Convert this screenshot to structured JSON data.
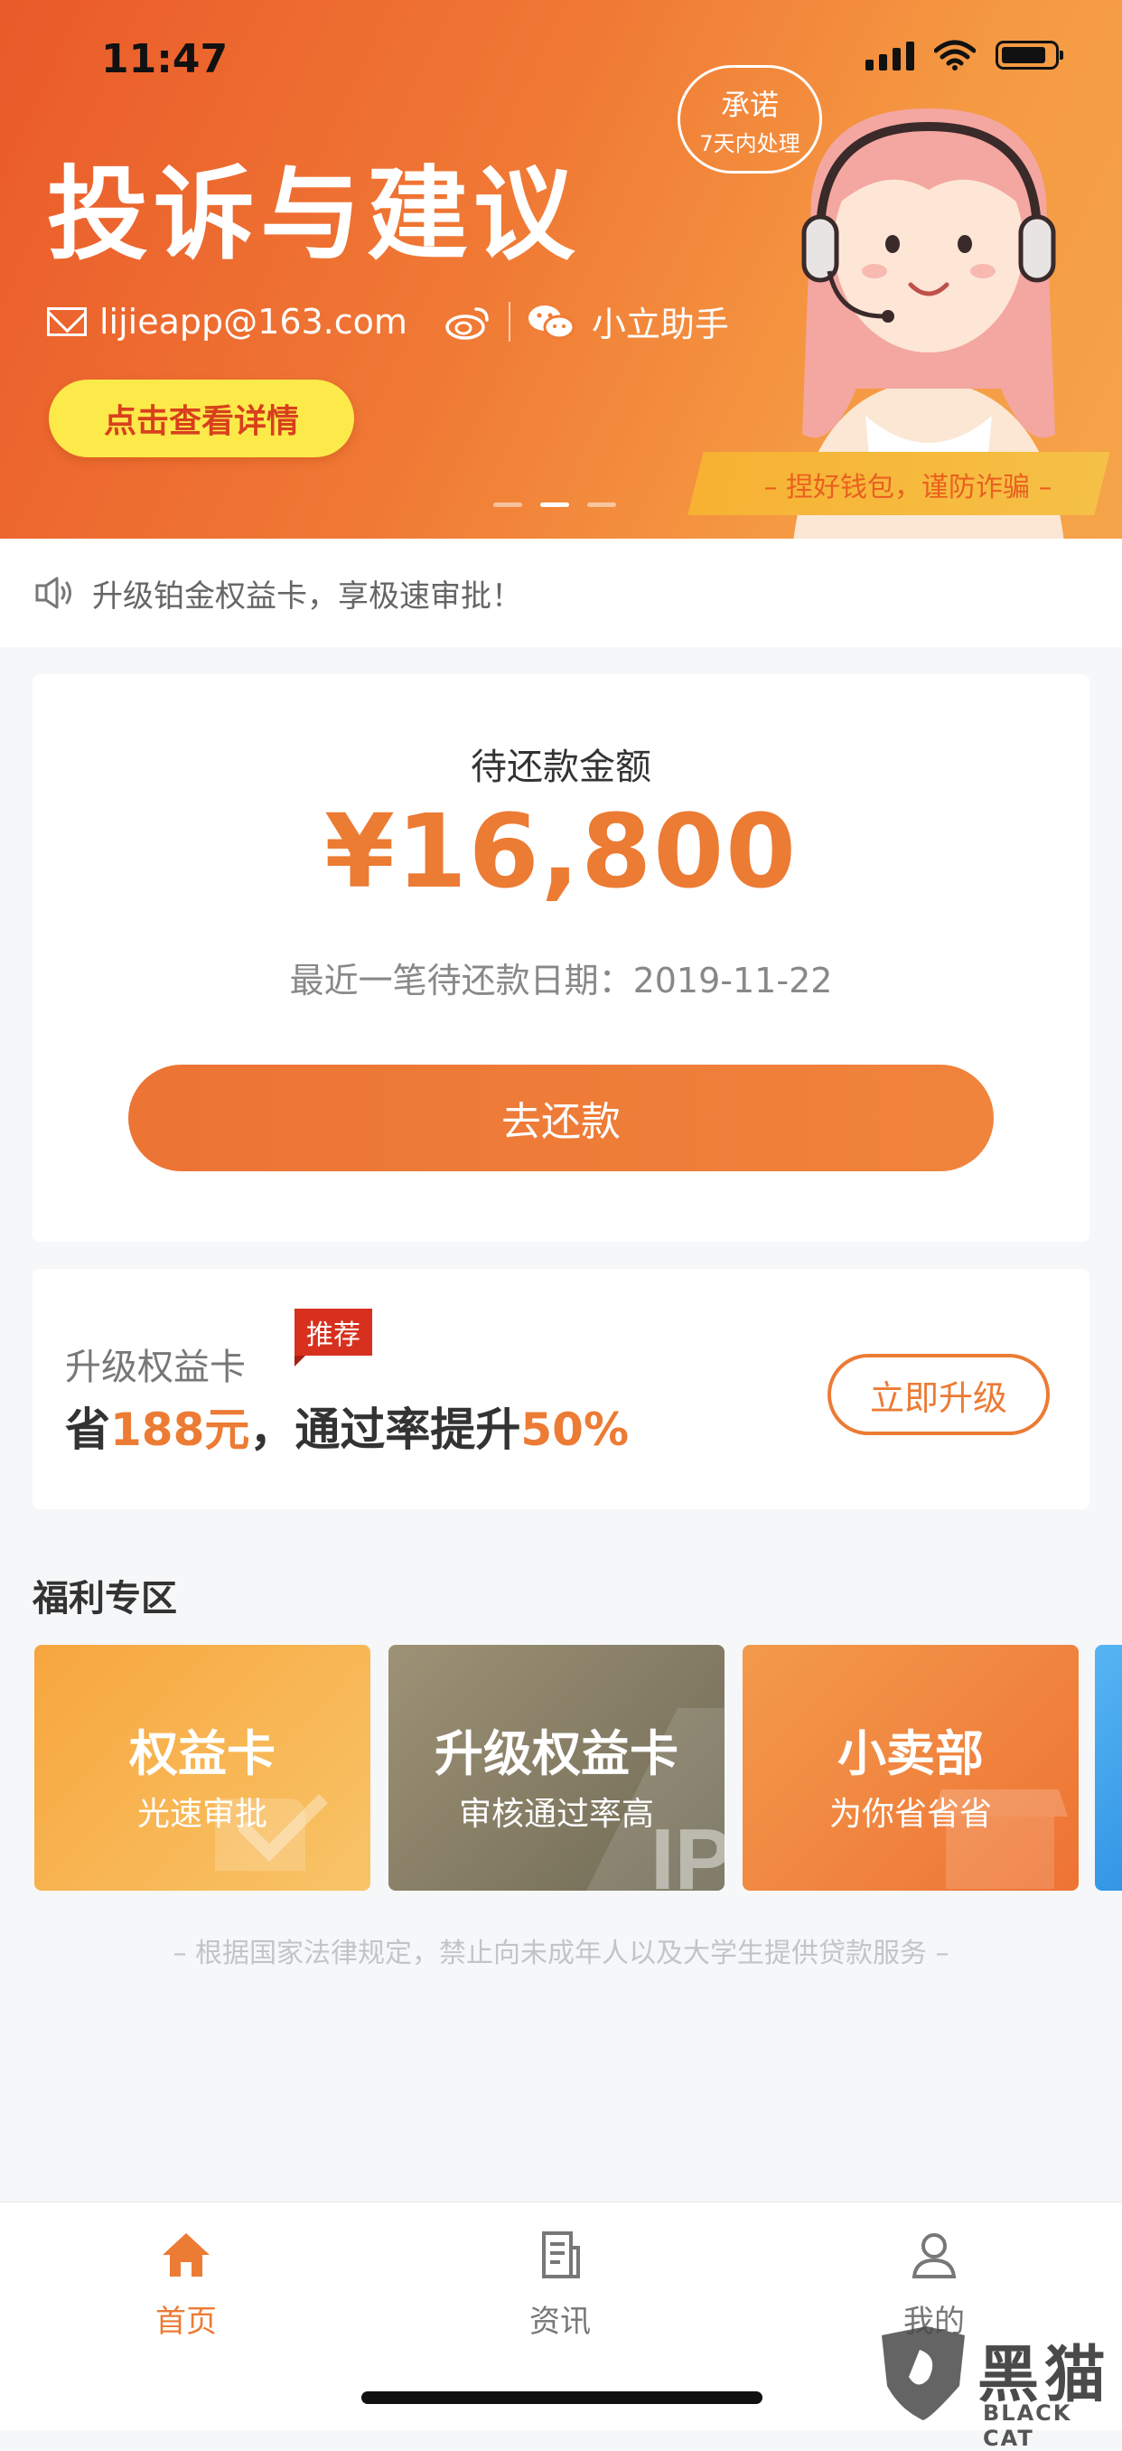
{
  "status_bar": {
    "time": "11:47"
  },
  "banner": {
    "title": "投诉与建议",
    "email": "lijieapp@163.com",
    "wechat_name": "小立助手",
    "cta_label": "点击查看详情",
    "promise_line1": "承诺",
    "promise_line2": "7天内处理",
    "warning": "– 捏好钱包，谨防诈骗 –",
    "active_dot_index": 1,
    "dot_count": 3
  },
  "notice": {
    "text": "升级铂金权益卡，享极速审批！"
  },
  "repayment": {
    "label": "待还款金额",
    "amount": "¥16,800",
    "date_line": "最近一笔待还款日期：2019-11-22",
    "button_label": "去还款"
  },
  "upgrade": {
    "title": "升级权益卡",
    "tag": "推荐",
    "line_prefix": "省",
    "line_amount": "188元",
    "line_middle": "，通过率提升",
    "line_rate": "50%",
    "button_label": "立即升级"
  },
  "welfare": {
    "title": "福利专区",
    "cards": [
      {
        "title": "权益卡",
        "subtitle": "光速审批"
      },
      {
        "title": "升级权益卡",
        "subtitle": "审核通过率高"
      },
      {
        "title": "小卖部",
        "subtitle": "为你省省省"
      }
    ]
  },
  "disclaimer": "– 根据国家法律规定，禁止向未成年人以及大学生提供贷款服务 –",
  "tabbar": {
    "tabs": [
      {
        "label": "首页",
        "icon": "home-icon",
        "active": true
      },
      {
        "label": "资讯",
        "icon": "news-icon",
        "active": false
      },
      {
        "label": "我的",
        "icon": "user-icon",
        "active": false
      }
    ]
  },
  "watermark": {
    "cn": "黑猫",
    "en": "BLACK CAT"
  },
  "colors": {
    "accent": "#ec7b34",
    "banner": "#ea5a2a",
    "tag": "#d7301f",
    "cta_yellow": "#fcea4a"
  }
}
